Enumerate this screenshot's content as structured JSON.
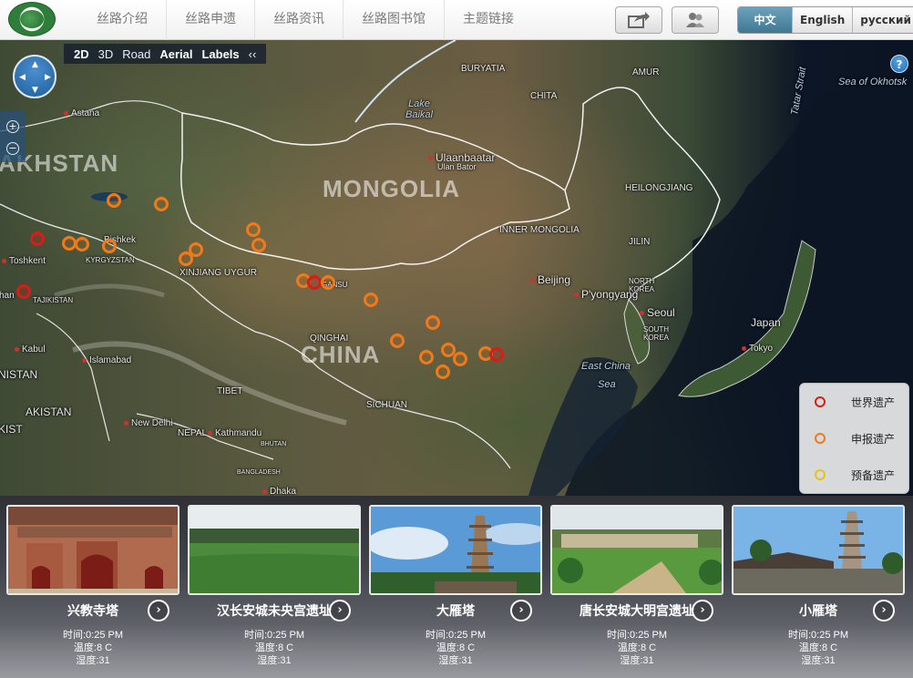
{
  "header": {
    "nav": [
      "丝路介绍",
      "丝路申遗",
      "丝路资讯",
      "丝路图书馆",
      "主题链接"
    ],
    "languages": [
      {
        "label": "中文",
        "active": true
      },
      {
        "label": "English",
        "active": false
      },
      {
        "label": "русский",
        "active": false
      }
    ]
  },
  "map": {
    "toolbar": [
      "2D",
      "3D",
      "Road",
      "Aerial",
      "Labels",
      "‹‹"
    ],
    "help_label": "?",
    "labels": {
      "kazakhstan": "AKHSTAN",
      "mongolia": "MONGOLIA",
      "china": "CHINA",
      "buryatia": "BURYATIA",
      "chita": "CHITA",
      "amur": "AMUR",
      "lake_baikal": "Lake Baikal",
      "tatar_strait": "Tatar Strait",
      "sea_of_okhotsk": "Sea of Okhotsk",
      "astana": "Astana",
      "ulaanbaatar": "Ulaanbaatar",
      "ulan_bator": "Ulan Bator",
      "heilongjiang": "HEILONGJIANG",
      "inner_mongolia": "INNER MONGOLIA",
      "jilin": "JILIN",
      "bishkek": "Bishkek",
      "kyrgyzstan": "KYRGYZSTAN",
      "toshkent": "Toshkent",
      "xinjiang": "XINJIANG UYGUR",
      "tajikistan": "TAJIKISTAN",
      "beijing": "Beijing",
      "north_korea": "NORTH KOREA",
      "pyongyang": "P'yongyang",
      "seoul": "Seoul",
      "south_korea": "SOUTH KOREA",
      "japan": "Japan",
      "tokyo": "Tokyo",
      "qinghai": "QINGHAI",
      "kabul": "Kabul",
      "islamabad": "Islamabad",
      "afghanistan": "NISTAN",
      "pakistan": "AKISTAN",
      "tibet": "TIBET",
      "sichuan": "SICHUAN",
      "east_china_sea": "East China",
      "east_china_sea2": "Sea",
      "new_delhi": "New Delhi",
      "nepal": "NEPAL",
      "kathmandu": "Kathmandu",
      "bhutan": "BHUTAN",
      "bangladesh": "BANGLADESH",
      "dhaka": "Dhaka",
      "gansu": "GANSU",
      "kisi": "KIST",
      "shn": "shan"
    },
    "legend": [
      {
        "label": "世界遗产",
        "color": "#d41e17"
      },
      {
        "label": "申报遗产",
        "color": "#f07a1a"
      },
      {
        "label": "预备遗产",
        "color": "#e8c21a"
      }
    ]
  },
  "cards": [
    {
      "title": "兴教寺塔",
      "time": "时间:0:25 PM",
      "temp": "温度:8 C",
      "humidity": "湿度:31"
    },
    {
      "title": "汉长安城未央宫遗址",
      "time": "时间:0:25 PM",
      "temp": "温度:8 C",
      "humidity": "湿度:31"
    },
    {
      "title": "大雁塔",
      "time": "时间:0:25 PM",
      "temp": "温度:8 C",
      "humidity": "湿度:31"
    },
    {
      "title": "唐长安城大明宫遗址",
      "time": "时间:0:25 PM",
      "temp": "温度:8 C",
      "humidity": "湿度:31"
    },
    {
      "title": "小雁塔",
      "time": "时间:0:25 PM",
      "temp": "温度:8 C",
      "humidity": "湿度:31"
    }
  ],
  "icons": {
    "logo": "silk-road-logo",
    "share": "share-icon",
    "user": "user-group-icon",
    "nav": "pan-control-icon",
    "zoom_in": "zoom-in-icon",
    "zoom_out": "zoom-out-icon",
    "arrow": "chevron-right-icon"
  }
}
